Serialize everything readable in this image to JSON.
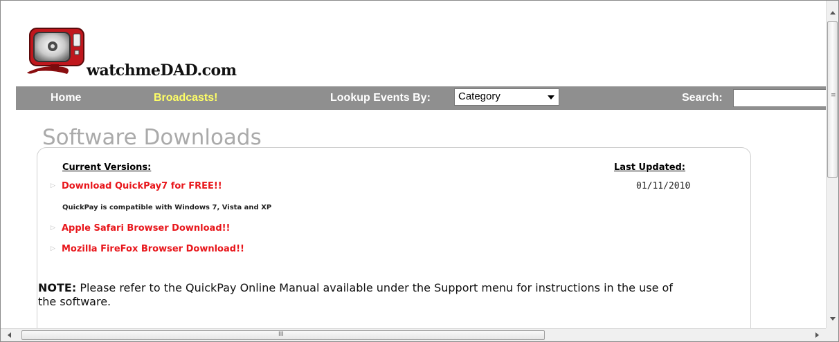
{
  "site": {
    "logo_text": "watchmeDAD.com"
  },
  "nav": {
    "home": "Home",
    "broadcasts": "Broadcasts!",
    "lookup_label": "Lookup Events By:",
    "lookup_selected": "Category",
    "search_label": "Search:",
    "search_value": ""
  },
  "content": {
    "title": "Software Downloads",
    "current_versions_header": "Current Versions:",
    "last_updated_header": "Last Updated:",
    "downloads": [
      {
        "label": "Download QuickPay7 for FREE!!",
        "date": "01/11/2010"
      },
      {
        "label": "Apple Safari Browser Download!!"
      },
      {
        "label": "Mozilla FireFox Browser Download!!"
      }
    ],
    "compat_note": "QuickPay is compatible with Windows 7, Vista and XP",
    "note_label": "NOTE:",
    "note_text": " Please refer to the QuickPay Online Manual available under the Support menu for instructions in the use of the software."
  },
  "colors": {
    "navbar": "#8f8f8f",
    "broadcasts": "#ffff66",
    "download_link": "#e8161b",
    "title": "#aaaaaa"
  },
  "icons": {
    "logo": "tv-icon",
    "bullet": "triangle-right-icon"
  }
}
